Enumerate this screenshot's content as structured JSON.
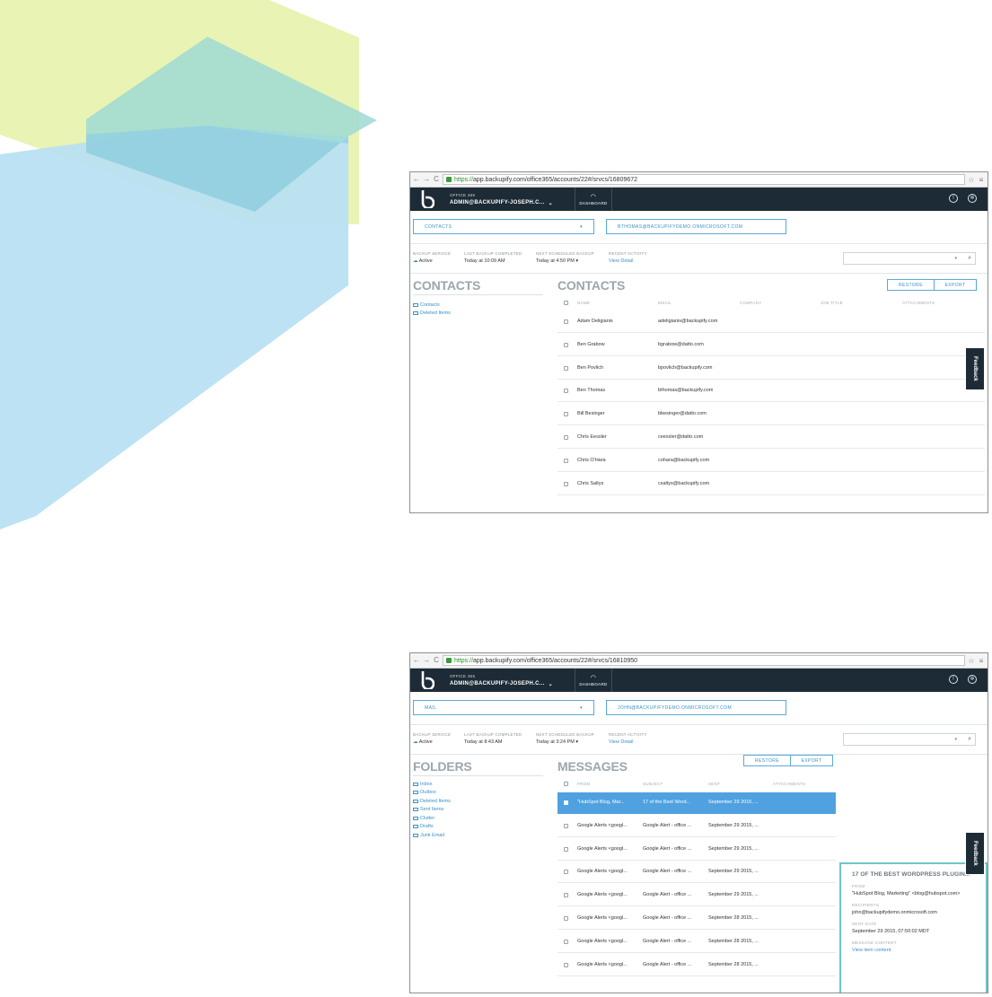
{
  "colors": {
    "header_bg": "#1d2b36",
    "accent_blue": "#3b8fc5",
    "selected_row": "#4fa1e0",
    "detail_border": "#6ec6c4",
    "decor_yellow": "#e8f3b4",
    "decor_teal": "#9fd9d3",
    "decor_blue": "#a9d8ef"
  },
  "screens": [
    {
      "url_https": "https://",
      "url_rest": "app.backupify.com/office365/accounts/22#/srvcs/16809672",
      "service": "OFFICE 365",
      "account": "ADMIN@BACKUPIFY-JOSEPH.C...",
      "dashboard": "DASHBOARD",
      "selector": "CONTACTS",
      "mailbox": "BTHOMAS@BACKUPIFYDEMO.ONMICROSOFT.COM",
      "status": {
        "backup_service_label": "BACKUP SERVICE",
        "backup_service_value": "Active",
        "last_label": "LAST BACKUP COMPLETED",
        "last_value": "Today at 10:09 AM",
        "next_label": "NEXT SCHEDULED BACKUP",
        "next_value": "Today at 4:50 PM",
        "recent_label": "RECENT ACTIVITY",
        "recent_value": "View Detail"
      },
      "sidebar_title": "CONTACTS",
      "folders": [
        "Contacts",
        "Deleted Items"
      ],
      "main_title": "CONTACTS",
      "restore": "RESTORE",
      "export": "EXPORT",
      "columns": [
        "NAME",
        "EMAIL",
        "COMPANY",
        "JOB TITLE",
        "ATTACHMENTS"
      ],
      "rows": [
        [
          "Adam Deligianis",
          "adeligianis@backupify.com"
        ],
        [
          "Ben Grabow",
          "bgrabow@datto.com"
        ],
        [
          "Ben Povlich",
          "bpovlich@backupify.com"
        ],
        [
          "Ben Thomas",
          "bthomas@backupify.com"
        ],
        [
          "Bill Besinger",
          "bbesinger@datto.com"
        ],
        [
          "Chris Eessler",
          "ceessler@datto.com"
        ],
        [
          "Chris O'Hara",
          "cohara@backupify.com"
        ],
        [
          "Chris Saltys",
          "csaltys@backupify.com"
        ]
      ],
      "feedback": "Feedback"
    },
    {
      "url_https": "https://",
      "url_rest": "app.backupify.com/office365/accounts/22#/srvcs/16810950",
      "service": "OFFICE 365",
      "account": "ADMIN@BACKUPIFY-JOSEPH.C...",
      "dashboard": "DASHBOARD",
      "selector": "MAIL",
      "mailbox": "JOHN@BACKUPIFYDEMO.ONMICROSOFT.COM",
      "status": {
        "backup_service_label": "BACKUP SERVICE",
        "backup_service_value": "Active",
        "last_label": "LAST BACKUP COMPLETED",
        "last_value": "Today at 8:43 AM",
        "next_label": "NEXT SCHEDULED BACKUP",
        "next_value": "Today at 3:24 PM",
        "recent_label": "RECENT ACTIVITY",
        "recent_value": "View Detail"
      },
      "sidebar_title": "FOLDERS",
      "folders": [
        "Inbox",
        "Outbox",
        "Deleted Items",
        "Sent Items",
        "Clutter",
        "Drafts",
        "Junk Email"
      ],
      "main_title": "MESSAGES",
      "restore": "RESTORE",
      "export": "EXPORT",
      "columns": [
        "FROM",
        "SUBJECT",
        "SENT",
        "ATTACHMENTS"
      ],
      "rows": [
        [
          "\"HubSpot Blog, Mar...",
          "17 of the Best Word...",
          "September 29 2015, ..."
        ],
        [
          "Google Alerts <googl...",
          "Google Alert - office ...",
          "September 29 2015, ..."
        ],
        [
          "Google Alerts <googl...",
          "Google Alert - office ...",
          "September 29 2015, ..."
        ],
        [
          "Google Alerts <googl...",
          "Google Alert - office ...",
          "September 29 2015, ..."
        ],
        [
          "Google Alerts <googl...",
          "Google Alert - office ...",
          "September 29 2015, ..."
        ],
        [
          "Google Alerts <googl...",
          "Google Alert - office ...",
          "September 28 2015, ..."
        ],
        [
          "Google Alerts <googl...",
          "Google Alert - office ...",
          "September 28 2015, ..."
        ],
        [
          "Google Alerts <googl...",
          "Google Alert - office ...",
          "September 28 2015, ..."
        ]
      ],
      "selected_row": 0,
      "feedback": "Feedback",
      "detail": {
        "title": "17 OF THE BEST WORDPRESS PLUGIN...",
        "close": "×",
        "from_label": "FROM",
        "from_value": "\"HubSpot Blog, Marketing\" <blog@hubspot.com>",
        "recipients_label": "RECIPIENTS",
        "recipients_value": "john@backupifydemo.onmicrosoft.com",
        "sent_label": "SENT DATE",
        "sent_value": "September 29 2015, 07:50:02 MDT",
        "content_label": "MESSAGE CONTENT",
        "content_value": "View item content"
      }
    }
  ]
}
